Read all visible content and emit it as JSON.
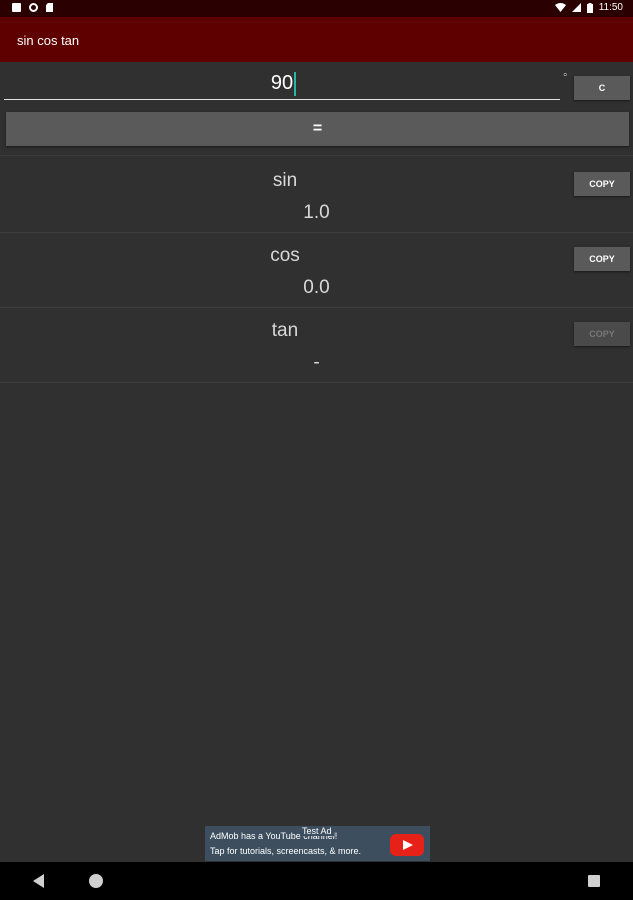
{
  "status_bar": {
    "time": "11:50",
    "icons": [
      "notification-icon",
      "record-icon",
      "sd-card-icon",
      "wifi-icon",
      "signal-icon",
      "battery-icon"
    ]
  },
  "app_bar": {
    "title": "sin cos tan"
  },
  "input": {
    "value": "90",
    "unit": "°"
  },
  "buttons": {
    "clear": "C",
    "equals": "="
  },
  "results": [
    {
      "function": "sin",
      "value": "1.0",
      "copy_label": "COPY",
      "copy_enabled": true
    },
    {
      "function": "cos",
      "value": "0.0",
      "copy_label": "COPY",
      "copy_enabled": true
    },
    {
      "function": "tan",
      "value": "-",
      "copy_label": "COPY",
      "copy_enabled": false
    }
  ],
  "ad": {
    "tag": "Test Ad",
    "line1": "AdMob has a YouTube channel!",
    "line2": "Tap for tutorials, screencasts, & more."
  },
  "colors": {
    "app_bar": "#5f0000",
    "status_bar": "#2a0000",
    "background": "#303030",
    "accent": "#2bb3a8"
  }
}
